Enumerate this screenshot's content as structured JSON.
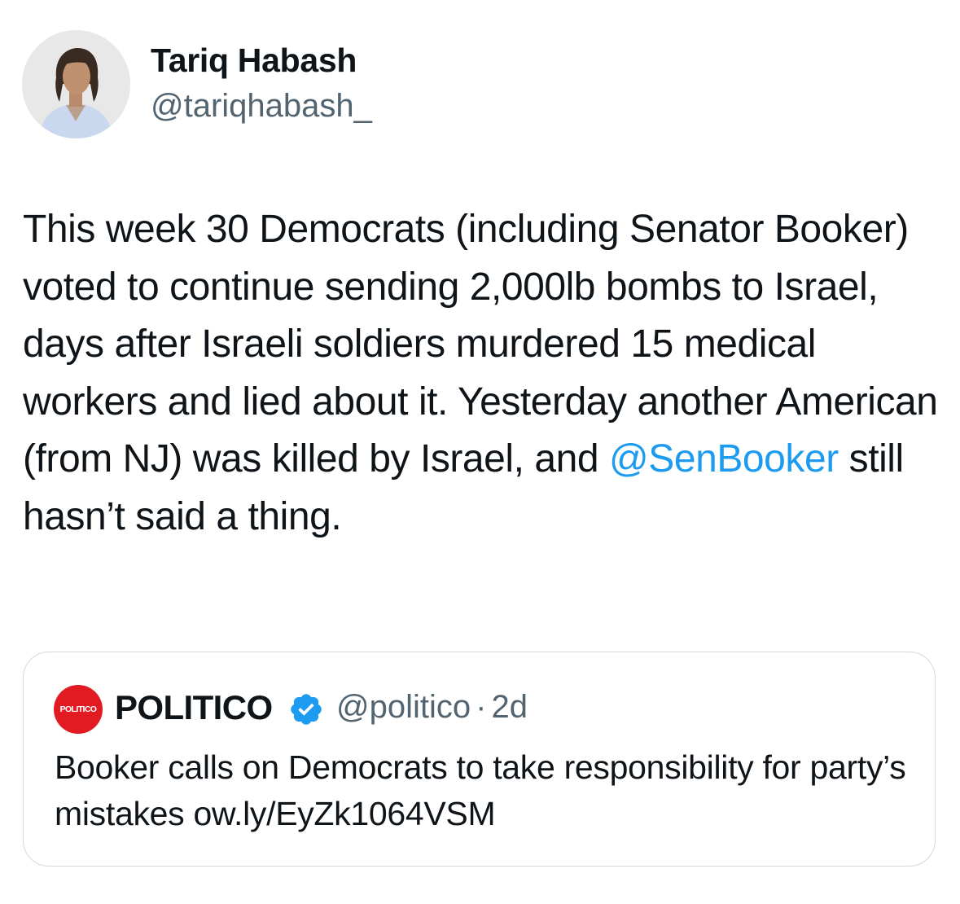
{
  "author": {
    "name": "Tariq Habash",
    "handle": "@tariqhabash_"
  },
  "tweet": {
    "text_before_mention": "This week 30 Democrats (including Senator Booker) voted to continue sending 2,000lb bombs to Israel, days after Israeli soldiers murdered 15 medical workers and lied about it. Yesterday another American (from NJ) was killed by Israel, and ",
    "mention": "@SenBooker",
    "text_after_mention": " still hasn’t said a thing."
  },
  "quote": {
    "logo_text": "POLITICO",
    "name": "POLITICO",
    "verified_icon": "verified-badge-icon",
    "handle": "@politico",
    "separator": "·",
    "time": "2d",
    "text": "Booker calls on Democrats to take responsibility for party’s mistakes ow.ly/EyZk1064VSM"
  },
  "colors": {
    "text": "#0f1419",
    "secondary": "#536471",
    "link": "#1d9bf0",
    "border": "#cfd9de",
    "politico_red": "#e21b23"
  }
}
